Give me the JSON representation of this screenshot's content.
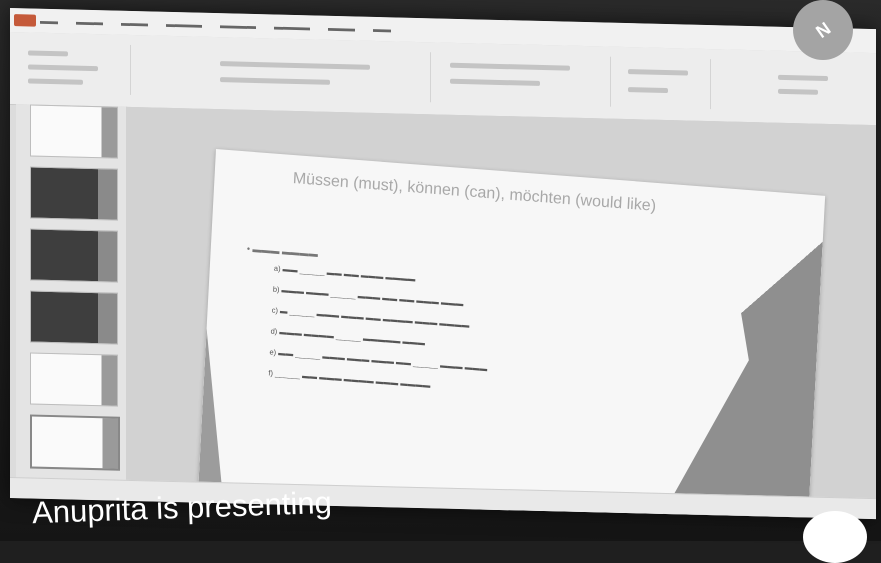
{
  "meeting": {
    "presenter_label": "Anuprita is presenting",
    "participant_badge": "N"
  },
  "slide": {
    "title": "Müssen (must), können (can), möchten (would like)"
  }
}
